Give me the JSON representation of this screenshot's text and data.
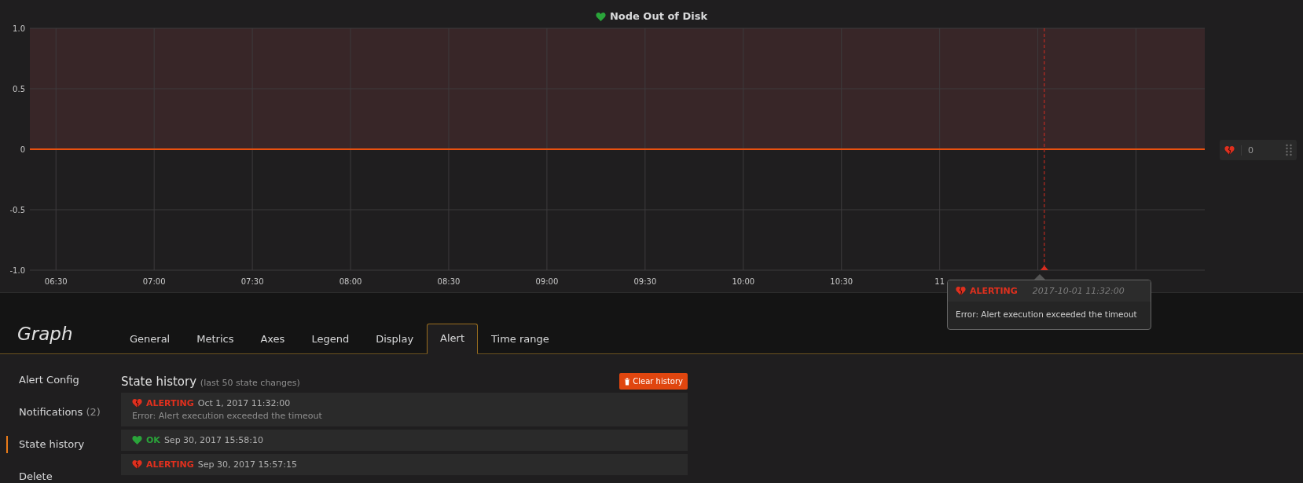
{
  "panel": {
    "title": "Node Out of Disk",
    "title_alerting": false,
    "chart_data": {
      "type": "line",
      "grid": true,
      "xlim": [
        6.367,
        12.35
      ],
      "ylim": [
        -1,
        1
      ],
      "xticks": [
        {
          "value": 6.5,
          "label": "06:30"
        },
        {
          "value": 7,
          "label": "07:00"
        },
        {
          "value": 7.5,
          "label": "07:30"
        },
        {
          "value": 8,
          "label": "08:00"
        },
        {
          "value": 8.5,
          "label": "08:30"
        },
        {
          "value": 9,
          "label": "09:00"
        },
        {
          "value": 9.5,
          "label": "09:30"
        },
        {
          "value": 10,
          "label": "10:00"
        },
        {
          "value": 10.5,
          "label": "10:30"
        },
        {
          "value": 11,
          "label": "11"
        }
      ],
      "yticks": [
        {
          "value": 1,
          "label": "1.0"
        },
        {
          "value": 0.5,
          "label": "0.5"
        },
        {
          "value": 0,
          "label": "0"
        },
        {
          "value": -0.5,
          "label": "-0.5"
        },
        {
          "value": -1,
          "label": "-1.0"
        }
      ],
      "x": [
        6.367,
        12.35
      ],
      "series": [
        {
          "color": "#e8500f",
          "values": [
            0,
            0
          ]
        }
      ],
      "bands": [
        {
          "axis": "y",
          "from": 0,
          "to": 1
        }
      ],
      "ref_lines": [
        {
          "axis": "x",
          "value": 11.533
        }
      ]
    },
    "threshold_handle": {
      "alerting": true,
      "value": "0"
    },
    "tooltip": {
      "alerting": true,
      "label": "ALERTING",
      "time": "2017-10-01 11:32:00",
      "text": "Error: Alert execution exceeded the timeout"
    }
  },
  "editor": {
    "title": "Graph",
    "tabs": [
      {
        "label": "General",
        "selected": false
      },
      {
        "label": "Metrics",
        "selected": false
      },
      {
        "label": "Axes",
        "selected": false
      },
      {
        "label": "Legend",
        "selected": false
      },
      {
        "label": "Display",
        "selected": false
      },
      {
        "label": "Alert",
        "selected": true
      },
      {
        "label": "Time range",
        "selected": false
      }
    ],
    "sidebar": [
      {
        "label": "Alert Config",
        "selected": false
      },
      {
        "label": "Notifications",
        "count": "(2)",
        "selected": false
      },
      {
        "label": "State history",
        "selected": true
      },
      {
        "label": "Delete",
        "selected": false
      }
    ],
    "history": {
      "title": "State history",
      "subtitle": "(last 50 state changes)",
      "clear_button": "Clear history",
      "rows": [
        {
          "alerting": true,
          "label": "ALERTING",
          "time": "Oct 1, 2017 11:32:00",
          "text": "Error: Alert execution exceeded the timeout"
        },
        {
          "alerting": false,
          "label": "OK",
          "time": "Sep 30, 2017 15:58:10"
        },
        {
          "alerting": true,
          "label": "ALERTING",
          "time": "Sep 30, 2017 15:57:15"
        }
      ]
    }
  }
}
